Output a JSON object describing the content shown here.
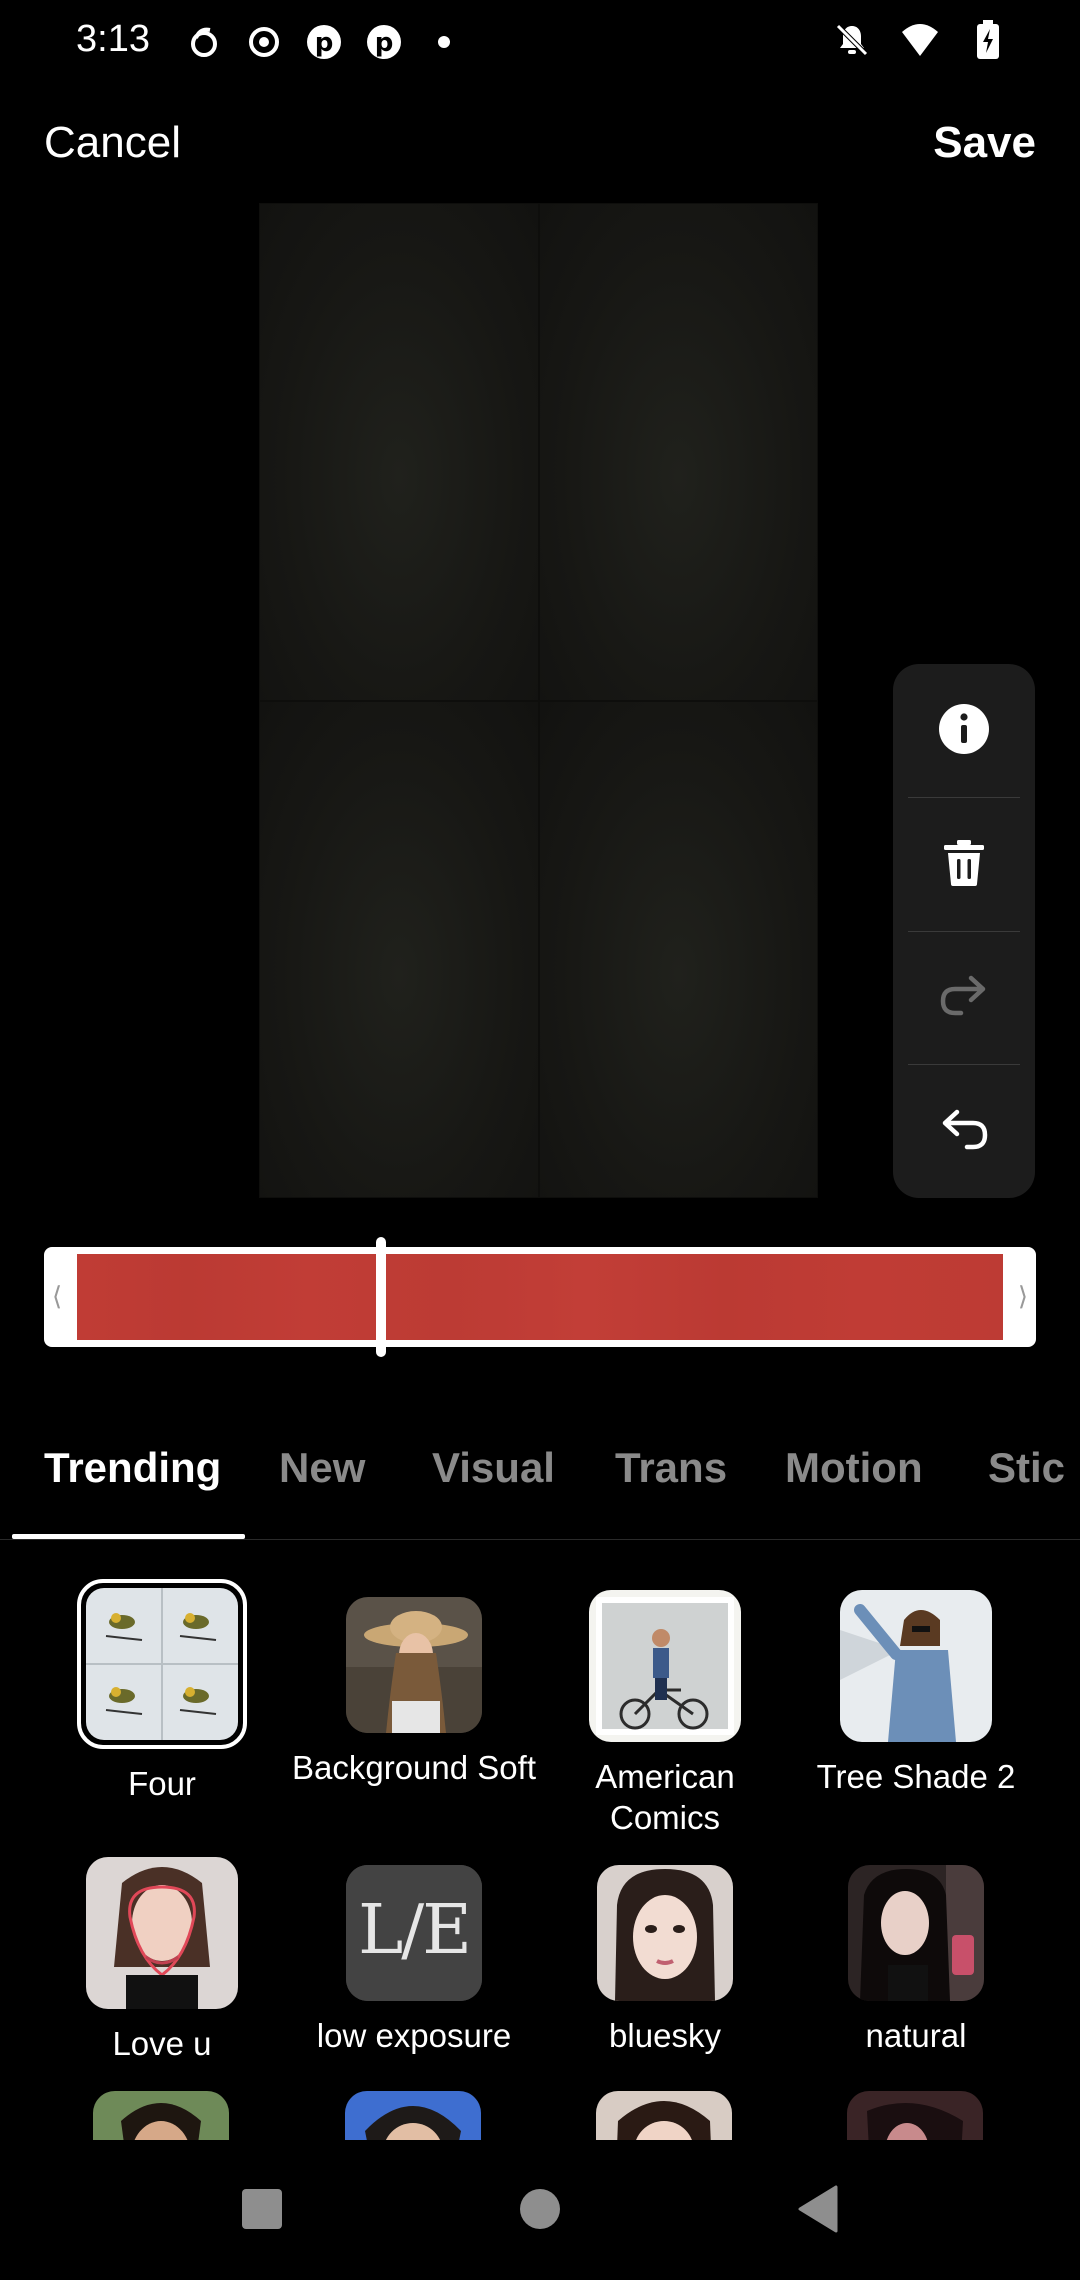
{
  "status_bar": {
    "time": "3:13"
  },
  "top_bar": {
    "cancel_label": "Cancel",
    "save_label": "Save"
  },
  "tabs": [
    {
      "label": "Trending",
      "active": true
    },
    {
      "label": "New",
      "active": false
    },
    {
      "label": "Visual",
      "active": false
    },
    {
      "label": "Trans",
      "active": false
    },
    {
      "label": "Motion",
      "active": false
    },
    {
      "label": "Stic",
      "active": false
    }
  ],
  "effects": {
    "row1": [
      {
        "label": "Four",
        "selected": true
      },
      {
        "label": "Background Soft",
        "selected": false
      },
      {
        "label": "American Comics",
        "selected": false
      },
      {
        "label": "Tree Shade 2",
        "selected": false
      }
    ],
    "row2": [
      {
        "label": "Love u"
      },
      {
        "label": "low exposure"
      },
      {
        "label": "bluesky"
      },
      {
        "label": "natural"
      }
    ]
  },
  "low_exposure_thumb_text": "L/E",
  "colors": {
    "timeline_track": "#c03c35",
    "background": "#000000",
    "toolbar": "#1c1c1c"
  }
}
